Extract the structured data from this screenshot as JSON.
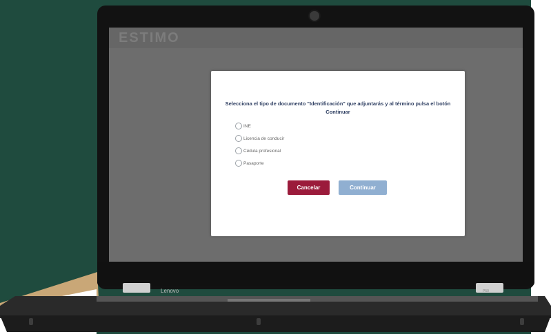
{
  "screen": {
    "logo_text": "ESTIMO"
  },
  "modal": {
    "title": "Selecciona el tipo de documento \"Identificación\" que adjuntarás y al término pulsa el botón Continuar",
    "options": [
      {
        "label": "INE"
      },
      {
        "label": "Licencia de conducir"
      },
      {
        "label": "Cédula profesional"
      },
      {
        "label": "Pasaporte"
      }
    ],
    "cancel_label": "Cancelar",
    "continue_label": "Continuar"
  },
  "laptop": {
    "brand": "Lenovo",
    "model": "P50"
  },
  "colors": {
    "background_green": "#1f4b3e",
    "accent_beige": "#c9a777",
    "cancel_button": "#9b1b3b",
    "continue_button": "#90afd1",
    "title_text": "#2f3f62"
  }
}
